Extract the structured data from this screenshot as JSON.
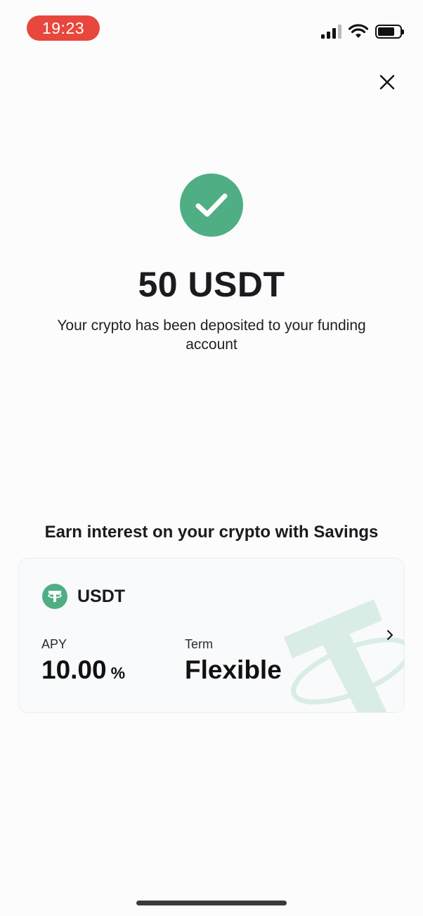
{
  "status_bar": {
    "time": "19:23",
    "icons": [
      "signal-icon",
      "wifi-icon",
      "battery-icon"
    ],
    "battery_level": 0.75
  },
  "close_icon": "close-icon",
  "success": {
    "icon": "checkmark-icon",
    "amount": "50 USDT",
    "message": "Your crypto has been deposited to your funding account"
  },
  "savings": {
    "title": "Earn interest on your crypto with Savings",
    "card": {
      "coin_icon": "tether-icon",
      "coin": "USDT",
      "apy_label": "APY",
      "apy_value": "10.00",
      "apy_unit": "%",
      "term_label": "Term",
      "term_value": "Flexible",
      "chevron_icon": "chevron-right-icon"
    }
  },
  "colors": {
    "accent_green": "#4fae83",
    "time_pill_red": "#e8473d",
    "text_primary": "#1b1b1f"
  }
}
